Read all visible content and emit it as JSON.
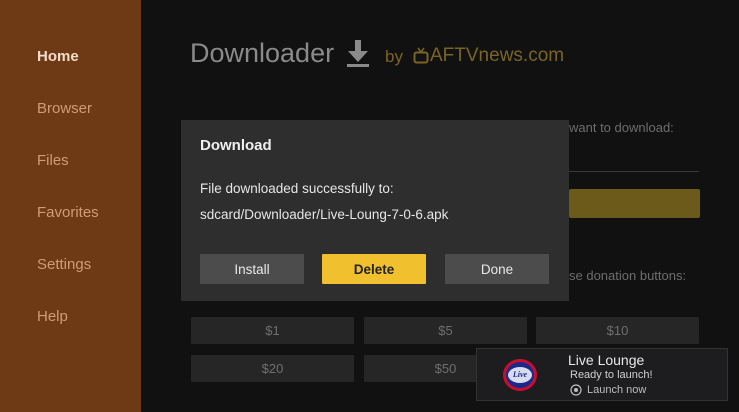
{
  "sidebar": {
    "items": [
      {
        "label": "Home",
        "active": true
      },
      {
        "label": "Browser"
      },
      {
        "label": "Files"
      },
      {
        "label": "Favorites"
      },
      {
        "label": "Settings"
      },
      {
        "label": "Help"
      }
    ]
  },
  "header": {
    "title": "Downloader",
    "by": "by",
    "brand": "AFTVnews.com",
    "icon": "download-arrow-icon"
  },
  "main": {
    "prompt_fragment": "want to download:",
    "donation_fragment": "se donation buttons:",
    "donations": [
      "$1",
      "$5",
      "$10",
      "$20",
      "$50"
    ]
  },
  "dialog": {
    "title": "Download",
    "message": "File downloaded successfully to:",
    "path": "sdcard/Downloader/Live-Loung-7-0-6.apk",
    "buttons": {
      "install": "Install",
      "delete": "Delete",
      "done": "Done"
    }
  },
  "toast": {
    "title": "Live Lounge",
    "subtitle": "Ready to launch!",
    "action": "Launch now",
    "logo_text": "Live"
  },
  "colors": {
    "sidebar": "#6e3915",
    "accent": "#f0c02e",
    "dialog": "#2e2e2e"
  }
}
